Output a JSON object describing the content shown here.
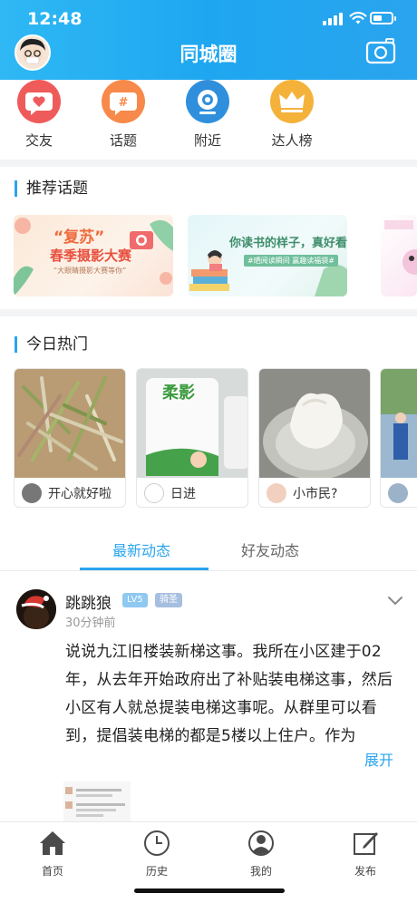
{
  "status_bar": {
    "time": "12:48"
  },
  "header": {
    "title": "同城圈"
  },
  "quick_nav": [
    {
      "label": "交友",
      "icon": "heart-chat-icon",
      "color": "#ef5b5b"
    },
    {
      "label": "话题",
      "icon": "hashtag-icon",
      "color": "#f7894a"
    },
    {
      "label": "附近",
      "icon": "location-eye-icon",
      "color": "#2f8fdc"
    },
    {
      "label": "达人榜",
      "icon": "crown-icon",
      "color": "#f5b23a"
    }
  ],
  "recommended": {
    "title": "推荐话题",
    "topics": [
      {
        "headline": "“复苏”",
        "subtitle": "春季摄影大赛",
        "tag": "“大眼睛摄影大赛等你”"
      },
      {
        "headline": "你读书的样子，真好看",
        "subtitle": "#晒阅读瞬间 赢趣读福袋#"
      }
    ]
  },
  "hot_today": {
    "title": "今日热门",
    "cards": [
      {
        "user": "开心就好啦"
      },
      {
        "user": "日进",
        "brand": "柔影"
      },
      {
        "user": "小市民?"
      },
      {
        "user": ""
      }
    ]
  },
  "feed_tabs": [
    {
      "label": "最新动态",
      "active": true
    },
    {
      "label": "好友动态",
      "active": false
    }
  ],
  "post": {
    "author": "跳跳狼",
    "level_badge": "LV5",
    "title_badge": "骑圣",
    "time": "30分钟前",
    "content": "说说九江旧楼装新梯这事。我所在小区建于02年，从去年开始政府出了补贴装电梯这事，然后小区有人就总提装电梯这事呢。从群里可以看到，提倡装电梯的都是5楼以上住户。作为",
    "expand_label": "展开"
  },
  "bottom_nav": [
    {
      "label": "首页",
      "icon": "home-icon"
    },
    {
      "label": "历史",
      "icon": "clock-icon"
    },
    {
      "label": "我的",
      "icon": "user-icon"
    },
    {
      "label": "发布",
      "icon": "edit-icon"
    }
  ],
  "colors": {
    "accent": "#2aa4ee",
    "header_start": "#2fb8f4"
  }
}
